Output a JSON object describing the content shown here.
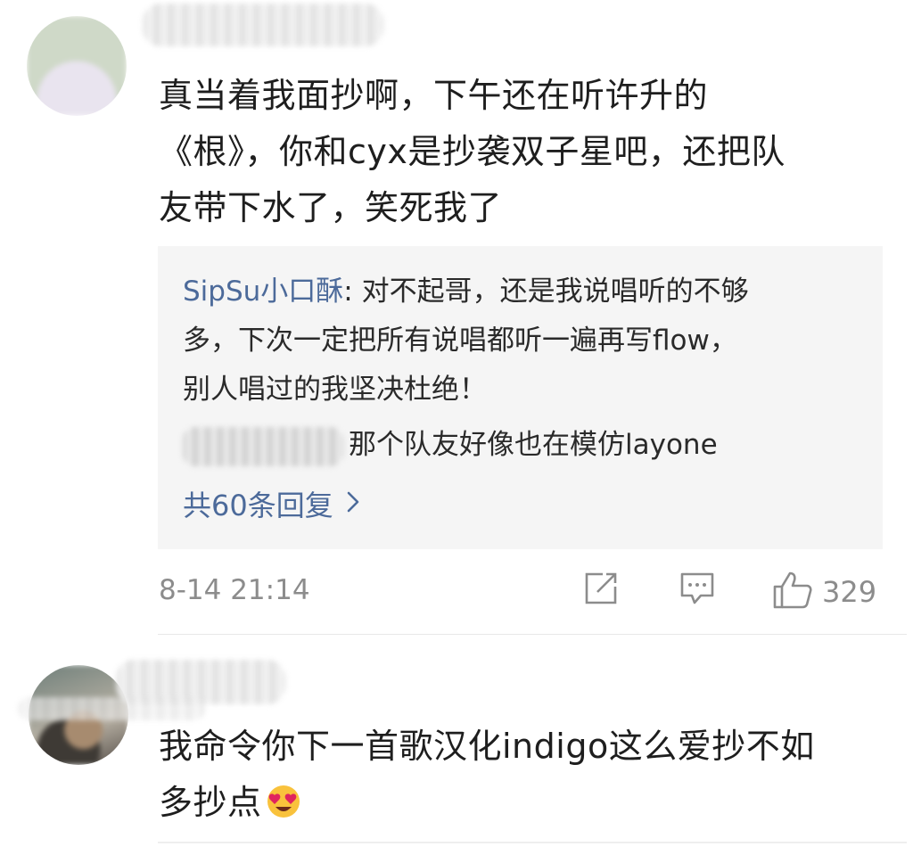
{
  "comment1": {
    "text_lines": [
      "真当着我面抄啊，下午还在听许升的",
      "《根》，你和cyx是抄袭双子星吧，还把队",
      "友带下水了，笑死我了"
    ],
    "replies": [
      {
        "author": "SipSu小口酥",
        "lines": [
          ": 对不起哥，还是我说唱听的不够",
          "多，下次一定把所有说唱都听一遍再写flow，",
          "别人唱过的我坚决杜绝！"
        ]
      },
      {
        "text": "那个队友好像也在模仿layone"
      }
    ],
    "more_replies_label": "共60条回复",
    "more_replies_chevron": "›",
    "timestamp": "8-14 21:14",
    "like_count": "329",
    "icons": {
      "share": "share-icon",
      "comment": "comment-icon",
      "like": "thumbs-up-icon"
    }
  },
  "comment2": {
    "text_lines": [
      "我命令你下一首歌汉化indigo这么爱抄不如",
      "多抄点"
    ],
    "emoji": "heart-eyes-emoji"
  },
  "colors": {
    "link_blue": "#4c6a9a",
    "meta_gray": "#8c8c8c",
    "reply_bg": "#f5f5f5"
  }
}
